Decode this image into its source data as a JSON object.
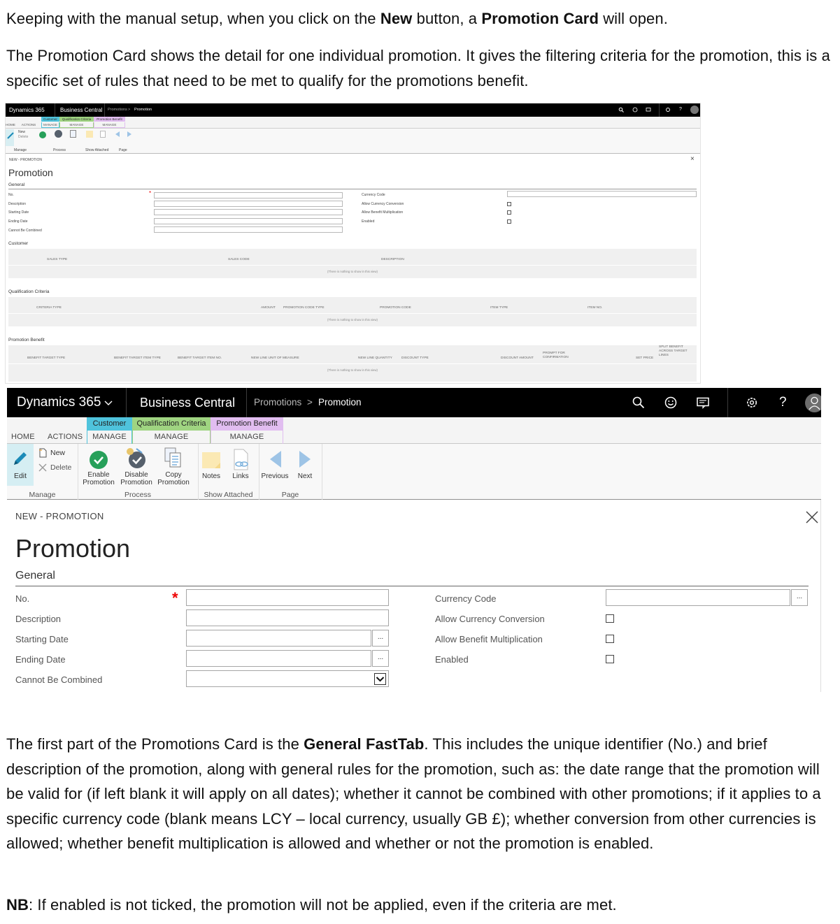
{
  "doc": {
    "p1": {
      "before": "Keeping with the manual setup, when you click on the ",
      "b1": "New",
      "mid": " button, a ",
      "b2": "Promotion Card",
      "after": " will open."
    },
    "p2": "The Promotion Card shows the detail for one individual promotion. It gives the filtering criteria for the promotion, this is a specific set of rules that need to be met to qualify for the promotions benefit.",
    "p3": {
      "before": "The first part of the Promotions Card is the ",
      "bold": "General FastTab",
      "after": ". This includes the unique identifier (No.) and brief description of the promotion, along with general rules for the promotion, such as: the date range that the promotion will be valid for (if left blank it will apply on all dates); whether it cannot be combined with other promotions; if it applies to a specific currency code (blank means LCY – local currency, usually GB £); whether conversion from other currencies is allowed; whether benefit multiplication is allowed and whether or not the promotion is enabled."
    },
    "p4": {
      "bold": "NB",
      "after": ": If enabled is not ticked, the promotion will not be applied, even if the criteria are met."
    }
  },
  "app": {
    "brand": "Dynamics 365",
    "product": "Business Central",
    "breadcrumb": {
      "parent": "Promotions",
      "separator": ">",
      "current": "Promotion"
    },
    "icons": [
      "search-icon",
      "smiley-icon",
      "chat-icon",
      "gear-icon",
      "help-icon",
      "user-icon"
    ],
    "help_glyph": "?",
    "tabs": {
      "home": "HOME",
      "actions": "ACTIONS"
    },
    "context_tabs": [
      {
        "title": "Customer",
        "sub": "MANAGE",
        "color": "#4fc3dc"
      },
      {
        "title": "Qualification Criteria",
        "sub": "MANAGE",
        "color": "#9fd481"
      },
      {
        "title": "Promotion Benefit",
        "sub": "MANAGE",
        "color": "#e1bdf0"
      }
    ],
    "ribbon": {
      "edit": "Edit",
      "new": "New",
      "delete": "Delete",
      "enable": [
        "Enable",
        "Promotion"
      ],
      "disable": [
        "Disable",
        "Promotion"
      ],
      "copy": [
        "Copy",
        "Promotion"
      ],
      "notes": "Notes",
      "links": "Links",
      "previous": "Previous",
      "next": "Next",
      "groups": {
        "manage": "Manage",
        "process": "Process",
        "show_attached": "Show Attached",
        "page": "Page"
      }
    },
    "card_caption": "NEW - PROMOTION",
    "page_title": "Promotion",
    "fasttab": "General",
    "fields_left": [
      "No.",
      "Description",
      "Starting Date",
      "Ending Date",
      "Cannot Be Combined"
    ],
    "fields_right": [
      "Currency Code",
      "Allow Currency Conversion",
      "Allow Benefit Multiplication",
      "Enabled"
    ],
    "assist_glyph": "...",
    "required_glyph": "*",
    "sections": {
      "customer": {
        "title": "Customer",
        "columns": [
          "SALES TYPE",
          "SALES CODE",
          "DESCRIPTION"
        ]
      },
      "qualification": {
        "title": "Qualification Criteria",
        "columns": [
          "CRITERIA TYPE",
          "AMOUNT",
          "PROMOTION CODE TYPE",
          "PROMOTION CODE",
          "ITEM TYPE",
          "ITEM NO."
        ]
      },
      "benefit": {
        "title": "Promotion Benefit",
        "columns": [
          "BENEFIT TARGET TYPE",
          "BENEFIT TARGET ITEM TYPE",
          "BENEFIT TARGET ITEM NO.",
          "NEW LINE UNIT OF MEASURE",
          "NEW LINE QUANTITY",
          "DISCOUNT TYPE",
          "DISCOUNT AMOUNT",
          "PROMPT FOR CONFIRMATION",
          "SET PRICE",
          "SPLIT BENEFIT ACROSS TARGET LINES"
        ]
      },
      "empty_text": "(There is nothing to show in this view)"
    }
  }
}
